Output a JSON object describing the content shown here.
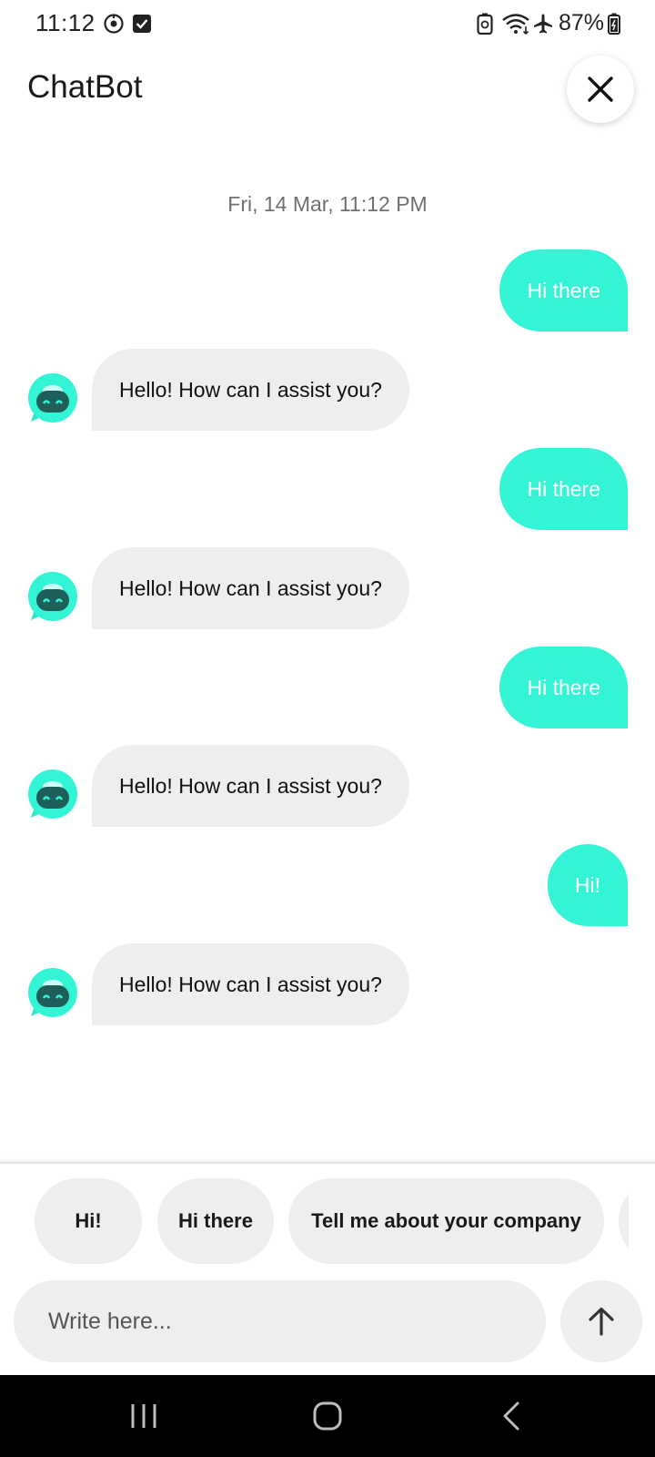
{
  "status_bar": {
    "time": "11:12",
    "battery": "87%",
    "icons": [
      "sync-icon",
      "checkbox-icon",
      "battery-saver-icon",
      "wifi-icon",
      "airplane-icon",
      "battery-icon"
    ]
  },
  "header": {
    "title": "ChatBot",
    "close_icon": "close-icon"
  },
  "chat": {
    "date": "Fri, 14 Mar, 11:12 PM",
    "messages": [
      {
        "from": "user",
        "text": "Hi there"
      },
      {
        "from": "bot",
        "text": "Hello! How can I assist you?"
      },
      {
        "from": "user",
        "text": "Hi there"
      },
      {
        "from": "bot",
        "text": "Hello! How can I assist you?"
      },
      {
        "from": "user",
        "text": "Hi there"
      },
      {
        "from": "bot",
        "text": "Hello! How can I assist you?"
      },
      {
        "from": "user",
        "text": "Hi!"
      },
      {
        "from": "bot",
        "text": "Hello! How can I assist you?"
      }
    ]
  },
  "quick_replies": [
    "Hi!",
    "Hi there",
    "Tell me about your company",
    ""
  ],
  "input": {
    "placeholder": "Write here...",
    "value": "",
    "send_icon": "arrow-up-icon"
  },
  "nav_bar": {
    "icons": [
      "recents-icon",
      "home-icon",
      "back-icon"
    ]
  },
  "colors": {
    "user_bubble": "#33f5d6",
    "bot_bubble": "#eeeeee",
    "nav_bar": "#000000"
  }
}
